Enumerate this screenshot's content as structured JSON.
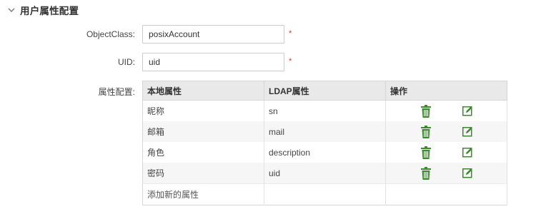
{
  "section": {
    "title": "用户属性配置",
    "chevron": "chevron-down-icon"
  },
  "form": {
    "objectclass": {
      "label": "ObjectClass:",
      "value": "posixAccount",
      "required_mark": "*"
    },
    "uid": {
      "label": "UID:",
      "value": "uid",
      "required_mark": "*"
    },
    "attr_config": {
      "label": "属性配置:"
    }
  },
  "table": {
    "headers": [
      "本地属性",
      "LDAP属性",
      "操作"
    ],
    "rows": [
      {
        "local": "昵称",
        "ldap": "sn"
      },
      {
        "local": "邮箱",
        "ldap": "mail"
      },
      {
        "local": "角色",
        "ldap": "description"
      },
      {
        "local": "密码",
        "ldap": "uid"
      }
    ],
    "add_label": "添加新的属性",
    "icons": {
      "delete": "trash-icon",
      "edit": "edit-icon"
    }
  },
  "colors": {
    "accent_green": "#3c8a2e",
    "required_red": "#e0312d",
    "header_bg": "#e9e9e9"
  }
}
